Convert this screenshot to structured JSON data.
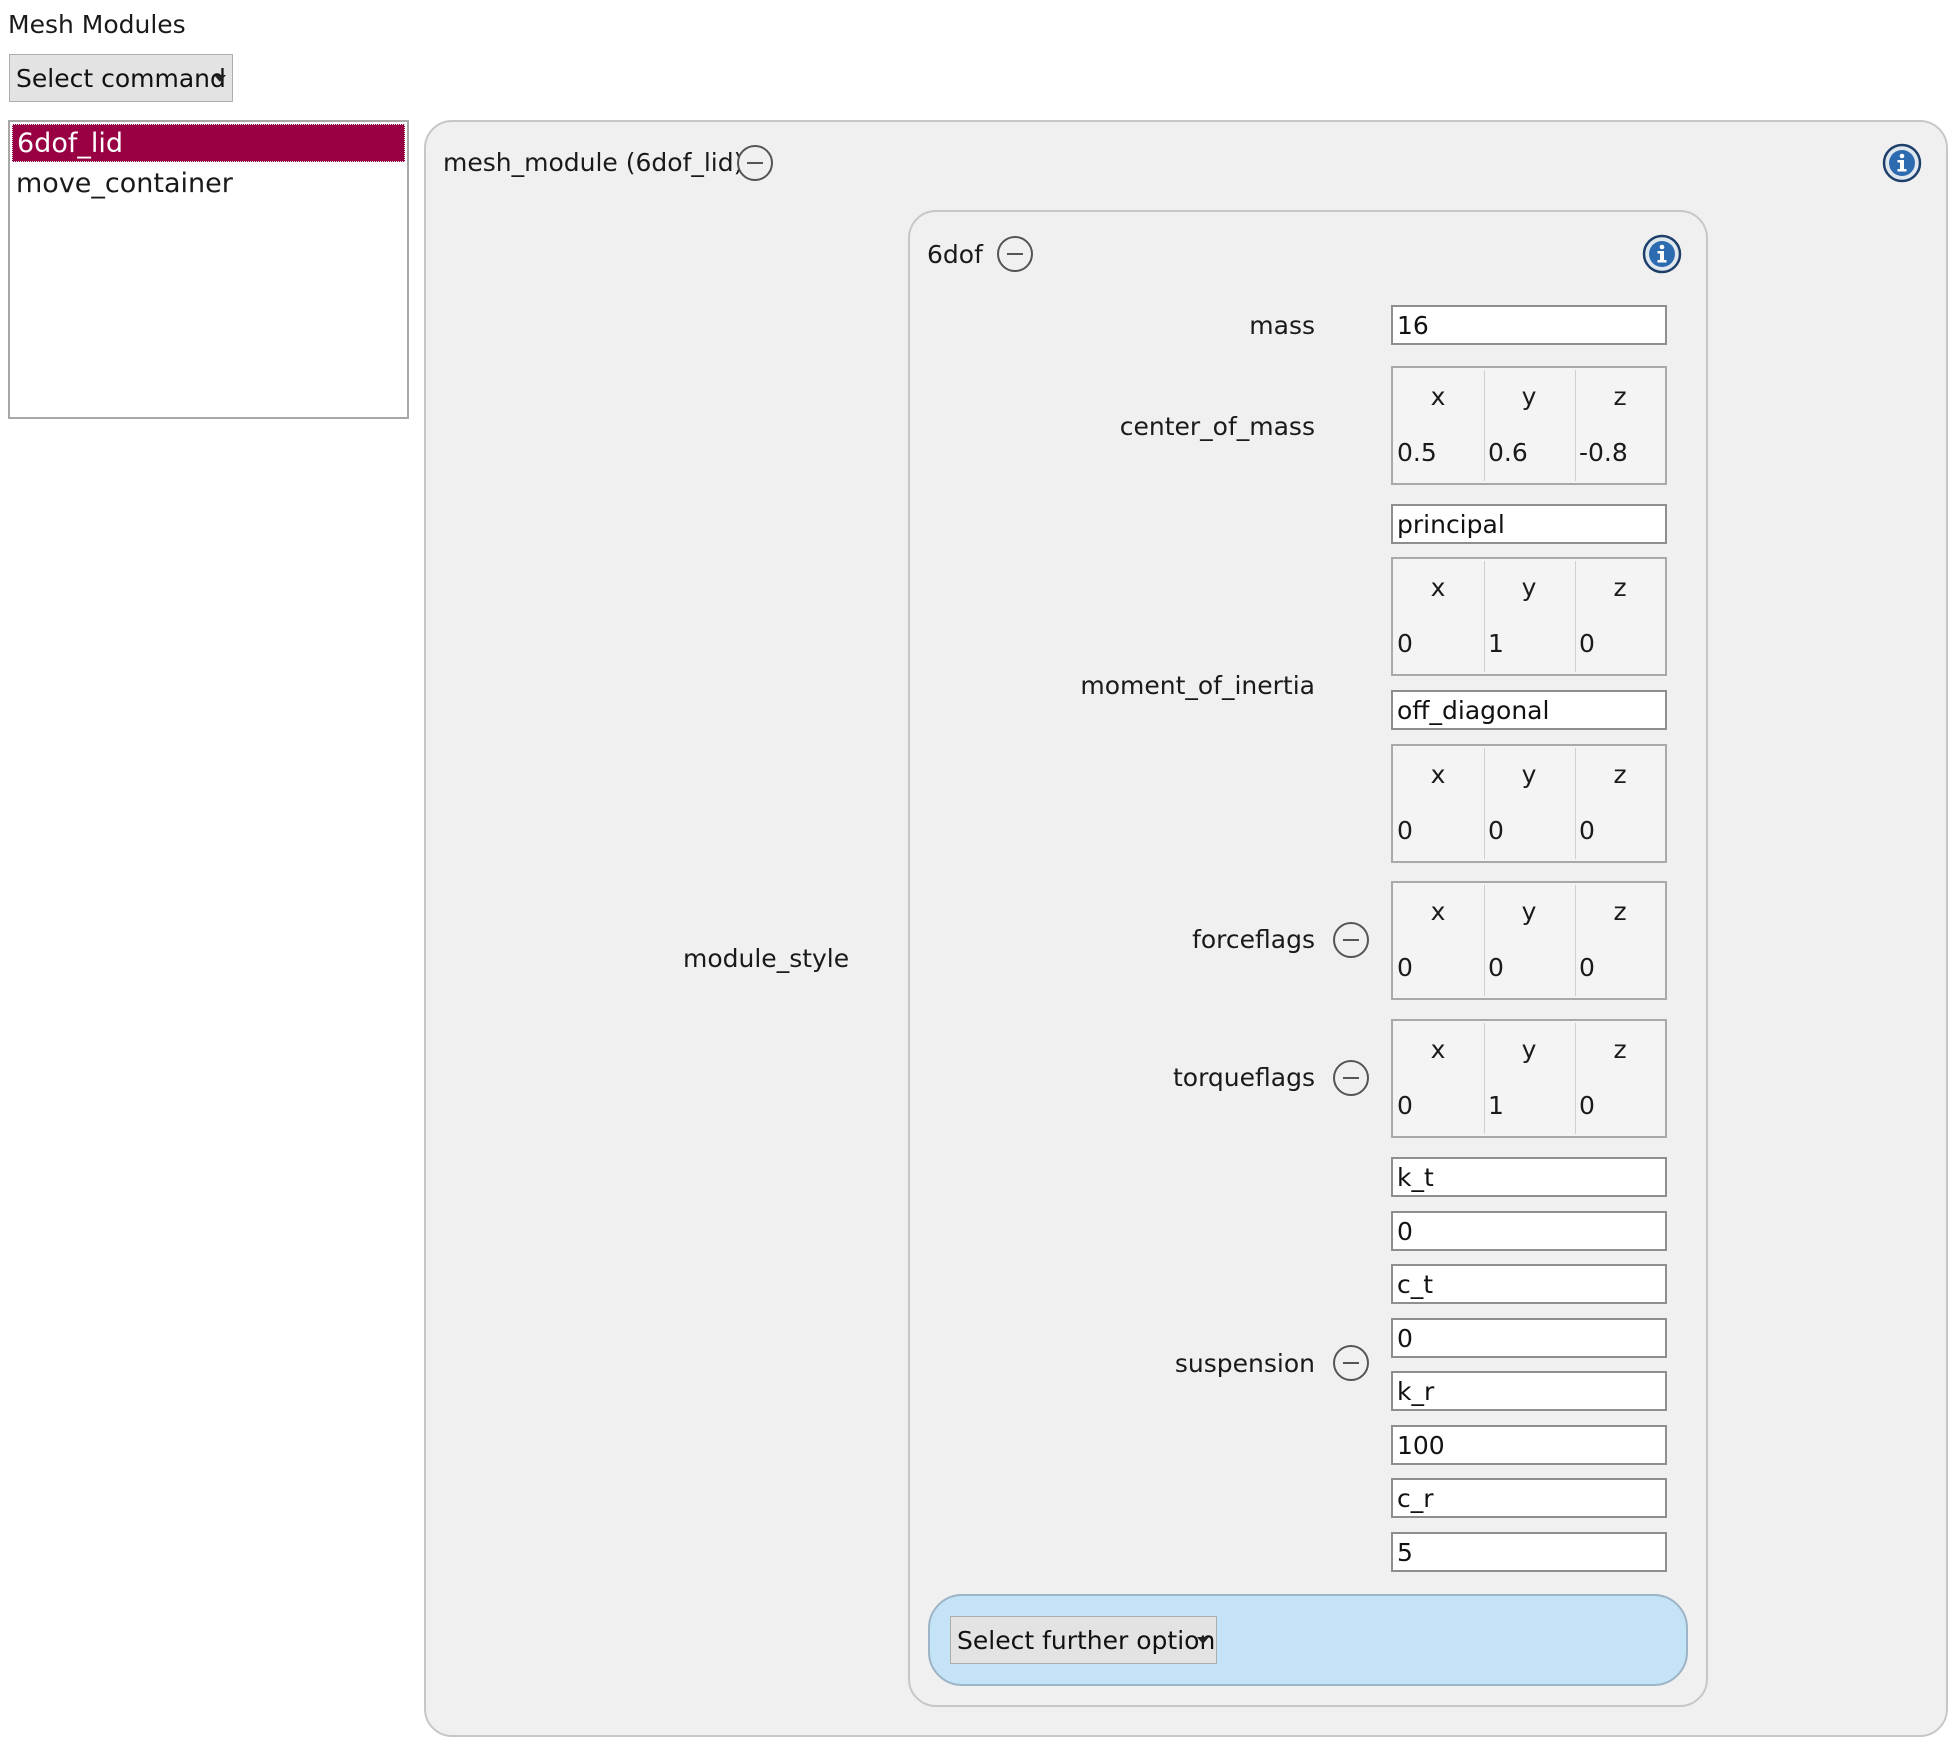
{
  "header": {
    "title": "Mesh Modules"
  },
  "command_dropdown": {
    "label": "Select command"
  },
  "modules_list": {
    "items": [
      "6dof_lid",
      "move_container"
    ],
    "selected": "6dof_lid"
  },
  "module_panel": {
    "title": "mesh_module (6dof_lid)",
    "style_label": "module_style",
    "dof_panel": {
      "title": "6dof",
      "mass": {
        "label": "mass",
        "value": "16"
      },
      "center_of_mass": {
        "label": "center_of_mass",
        "headers": [
          "x",
          "y",
          "z"
        ],
        "values": [
          "0.5",
          "0.6",
          "-0.8"
        ]
      },
      "moment_of_inertia": {
        "label": "moment_of_inertia",
        "principal_label": "principal",
        "principal_headers": [
          "x",
          "y",
          "z"
        ],
        "principal_values": [
          "0",
          "1",
          "0"
        ],
        "off_diagonal_label": "off_diagonal",
        "off_diagonal_headers": [
          "x",
          "y",
          "z"
        ],
        "off_diagonal_values": [
          "0",
          "0",
          "0"
        ]
      },
      "forceflags": {
        "label": "forceflags",
        "headers": [
          "x",
          "y",
          "z"
        ],
        "values": [
          "0",
          "0",
          "0"
        ]
      },
      "torqueflags": {
        "label": "torqueflags",
        "headers": [
          "x",
          "y",
          "z"
        ],
        "values": [
          "0",
          "1",
          "0"
        ]
      },
      "suspension": {
        "label": "suspension",
        "fields": [
          "k_t",
          "0",
          "c_t",
          "0",
          "k_r",
          "100",
          "c_r",
          "5"
        ]
      },
      "further_option": {
        "label": "Select further option"
      }
    }
  },
  "colors": {
    "selection": "#990044",
    "panel_bg": "#f0f0f0",
    "further_bar_bg": "#c5e3f6"
  },
  "icons": {
    "collapse": "minus-circle-icon",
    "info": "info-circle-icon",
    "dropdown": "caret-down-icon"
  }
}
